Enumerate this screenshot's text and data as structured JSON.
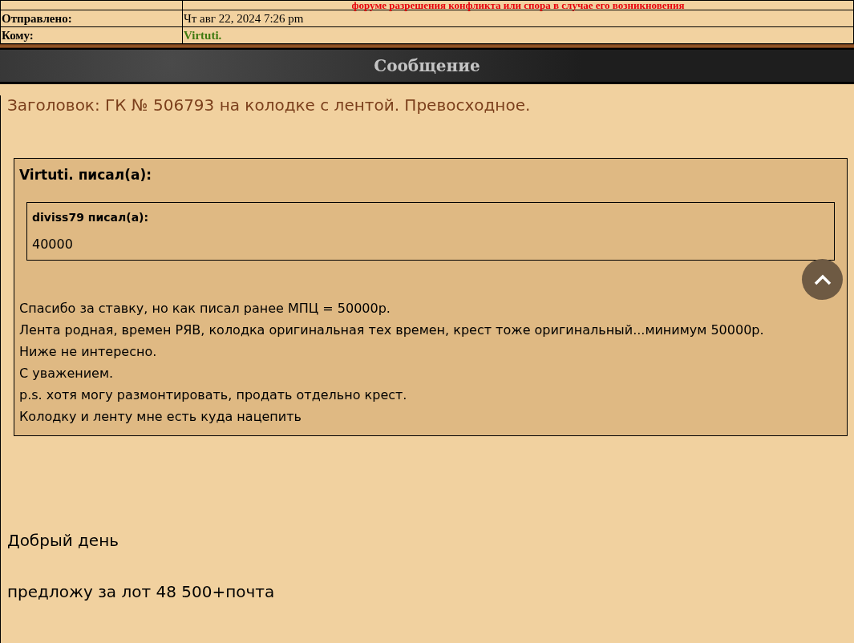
{
  "header_rows": [
    {
      "label": "",
      "value": "форуме разрешения конфликта или спора в случае его возникновения",
      "kind": "notice"
    },
    {
      "label": "Отправлено:",
      "value": "Чт авг 22, 2024 7:26 pm",
      "kind": "date"
    },
    {
      "label": "Кому:",
      "value": "Virtuti.",
      "kind": "user"
    }
  ],
  "section_title": "Сообщение",
  "subject": "Заголовок: ГК № 506793 на колодке с лентой. Превосходное.",
  "quote": {
    "author": "Virtuti. писал(а):",
    "inner_quote": {
      "author": "diviss79 писал(а):",
      "text": "40000"
    },
    "lines": [
      "Спасибо за ставку, но как писал ранее МПЦ = 50000р.",
      "Лента родная, времен РЯВ, колодка оригинальная тех времен, крест тоже оригинальный...минимум 50000р.",
      "Ниже не интересно.",
      "С уважением.",
      "p.s. хотя могу размонтировать, продать отдельно крест.",
      "Колодку и ленту мне есть куда нацепить"
    ]
  },
  "reply_lines": [
    "Добрый день",
    "предложу за лот 48 500+почта"
  ]
}
